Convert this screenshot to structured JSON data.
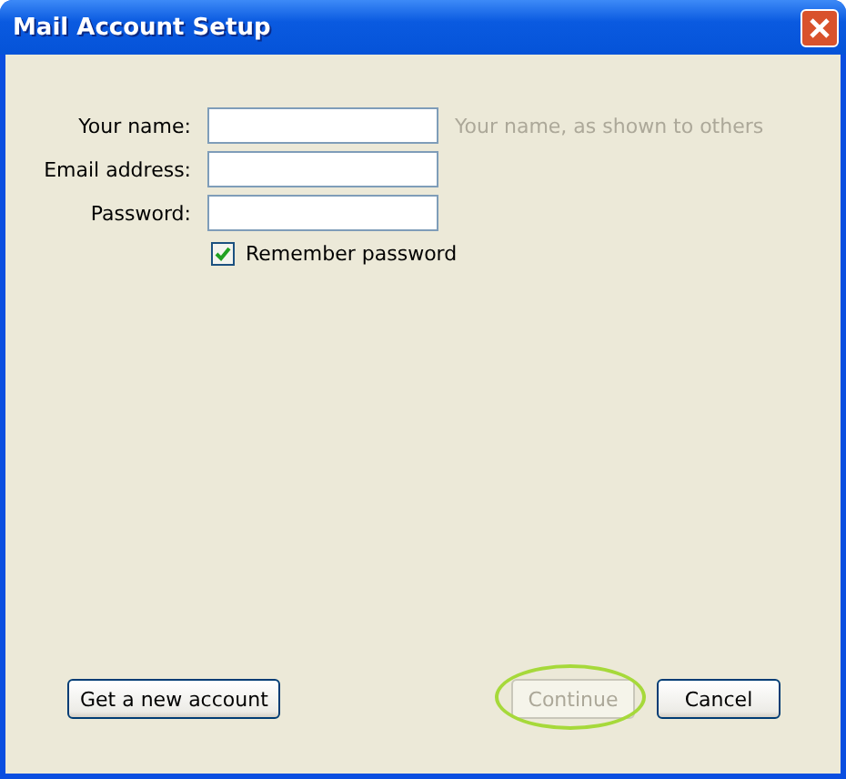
{
  "window": {
    "title": "Mail Account Setup"
  },
  "fields": [
    {
      "label": "Your name:",
      "hint": "Your name, as shown to others"
    },
    {
      "label": "Email address:"
    },
    {
      "label": "Password:"
    }
  ],
  "remember": {
    "label": "Remember password",
    "checked": true
  },
  "buttons": [
    {
      "label": "Get a new account",
      "kind": "left",
      "disabled": false,
      "highlighted": false
    },
    {
      "label": "Continue",
      "kind": "right",
      "disabled": true,
      "highlighted": true
    },
    {
      "label": "Cancel",
      "kind": "right",
      "disabled": false,
      "highlighted": false
    }
  ]
}
